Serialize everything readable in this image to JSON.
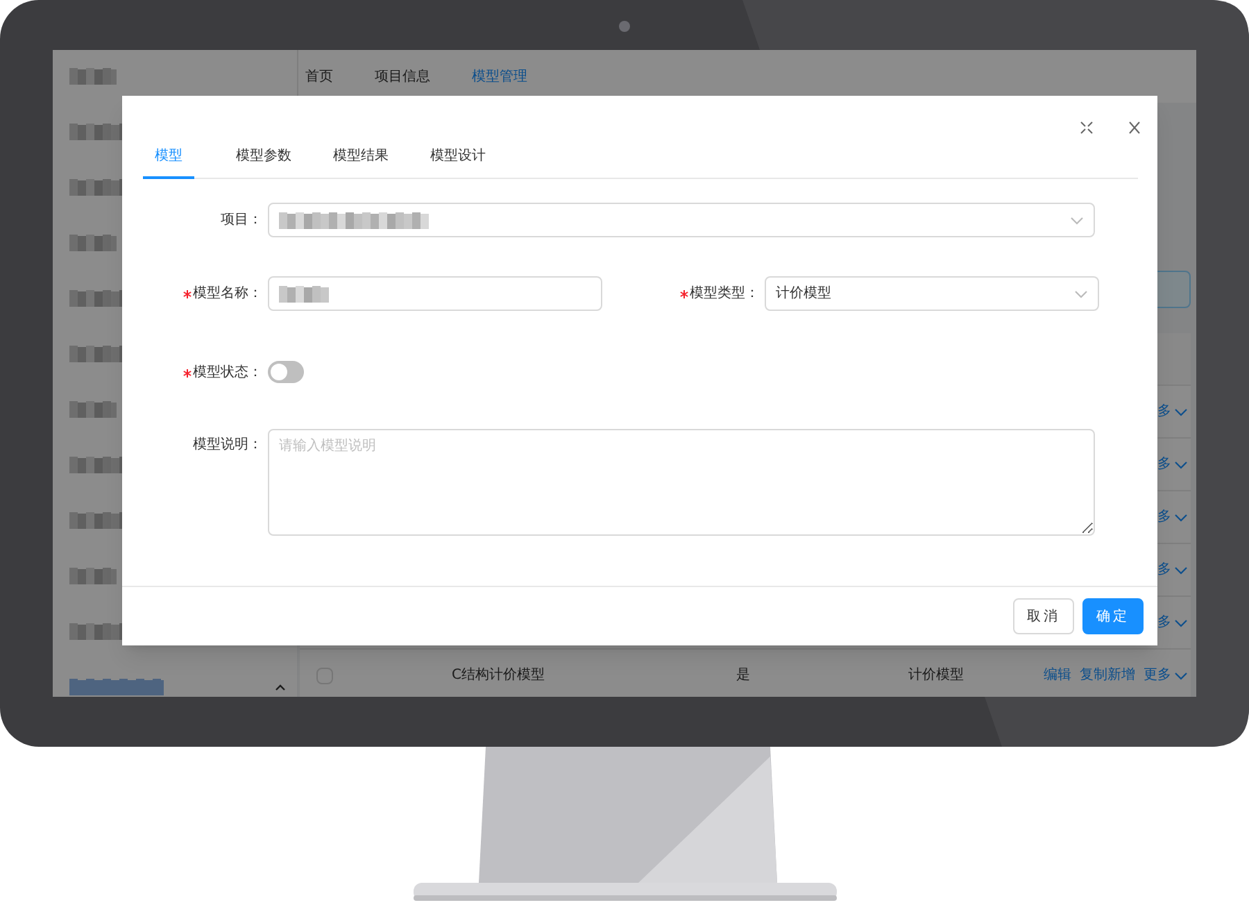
{
  "nav": {
    "items": [
      {
        "label": "首页",
        "selected": false
      },
      {
        "label": "项目信息",
        "selected": false
      },
      {
        "label": "模型管理",
        "selected": true
      }
    ]
  },
  "table": {
    "rows": [
      {
        "actions": [
          "多"
        ]
      },
      {
        "actions": [
          "多"
        ]
      },
      {
        "actions": [
          "多"
        ]
      },
      {
        "actions": [
          "多"
        ]
      },
      {
        "actions": [
          "多"
        ]
      },
      {
        "checked": false,
        "name": "C结构计价模型",
        "column_3": "是",
        "type": "计价模型",
        "actions": [
          "编辑",
          "复制新增",
          "更多"
        ]
      }
    ]
  },
  "dialog": {
    "tabs": [
      {
        "label": "模型",
        "selected": true
      },
      {
        "label": "模型参数",
        "selected": false
      },
      {
        "label": "模型结果",
        "selected": false
      },
      {
        "label": "模型设计",
        "selected": false
      }
    ],
    "fields": [
      {
        "kind": "select",
        "label": "项目：",
        "required": false,
        "half": false
      },
      {
        "kind": "input",
        "label": "模型名称：",
        "required": true,
        "half": true
      },
      {
        "kind": "select",
        "label": "模型类型：",
        "required": true,
        "half": true,
        "value": "计价模型"
      },
      {
        "kind": "switch",
        "label": "模型状态：",
        "required": true,
        "half": false,
        "on": false
      },
      {
        "kind": "textarea",
        "label": "模型说明：",
        "required": false,
        "half": false,
        "placeholder": "请输入模型说明"
      }
    ],
    "buttons": [
      {
        "label": "取消",
        "kind": "default"
      },
      {
        "label": "确定",
        "kind": "primary"
      }
    ]
  }
}
